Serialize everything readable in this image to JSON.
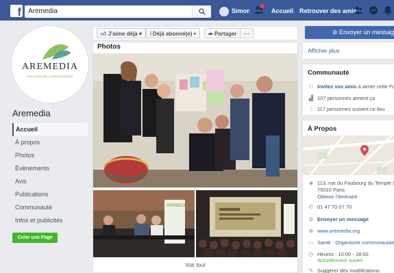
{
  "topbar": {
    "logo": "f",
    "search_value": "Aremedia",
    "user_name": "Simon",
    "home_label": "Accueil",
    "find_friends_label": "Retrouver des amis"
  },
  "profile": {
    "logo_text": "AREMEDIA",
    "logo_tagline": "LES CLÉS DE LA PRÉVENTION",
    "page_name": "Aremedia"
  },
  "leftnav": {
    "items": [
      {
        "label": "Accueil",
        "active": true
      },
      {
        "label": "À propos"
      },
      {
        "label": "Photos"
      },
      {
        "label": "Évènements"
      },
      {
        "label": "Avis"
      },
      {
        "label": "Publications"
      },
      {
        "label": "Communauté"
      },
      {
        "label": "Infos et publicités"
      }
    ],
    "create_page_label": "Créer une Page"
  },
  "actions": {
    "like_label": "J’aime déjà",
    "follow_label": "Déjà abonné(e)",
    "share_label": "Partager",
    "more_label": "···",
    "send_message_label": "Envoyer un message"
  },
  "photos": {
    "title": "Photos",
    "see_all_label": "Voir tout",
    "banner_text": "AREMEDIA"
  },
  "right": {
    "show_more_label": "Afficher plus",
    "community": {
      "title": "Communauté",
      "invite_link": "Invitez vos amis",
      "invite_rest": " à aimer cette Page",
      "likes_text": "107 personnes aiment ça",
      "followers_text": "117 personnes suivent ce lieu"
    },
    "about": {
      "title": "À Propos",
      "address_line1": "113, rue du Faubourg du Temple (2",
      "address_line2": "75010 Paris",
      "directions": "Obtenir l’itinéraire",
      "phone": "01 47 70 07 70",
      "send_message": "Envoyer un message",
      "website": "www.aremedia.org",
      "category": "Santé · Organisme communautaire",
      "hours": "Heures : 10:00 - 18:00",
      "open_status": "Actuellement ouvert",
      "suggest_edits": "Suggérer des modifications"
    }
  },
  "colors": {
    "fb_blue": "#3b5998",
    "button_blue": "#4267b2",
    "green": "#42b72a",
    "background": "#e9ebee"
  }
}
